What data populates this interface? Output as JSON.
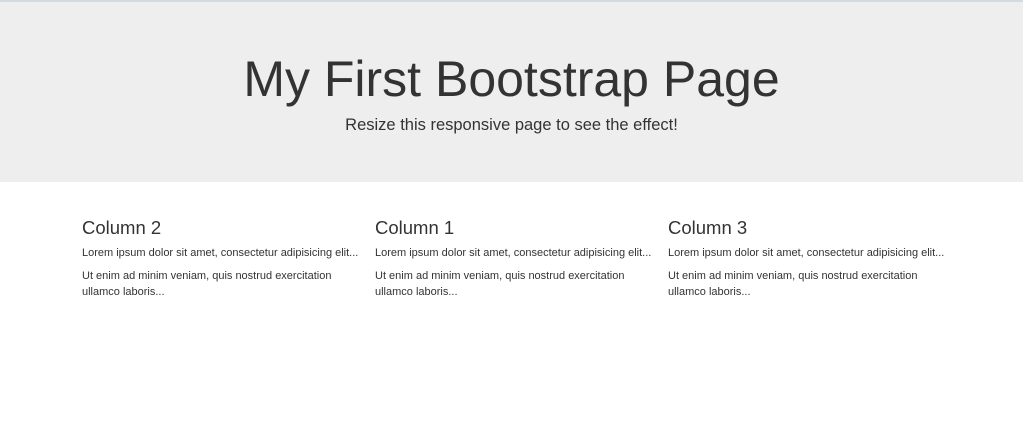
{
  "jumbotron": {
    "title": "My First Bootstrap Page",
    "subtitle": "Resize this responsive page to see the effect!"
  },
  "columns": [
    {
      "heading": "Column 2",
      "paragraph1": "Lorem ipsum dolor sit amet, consectetur adipisicing elit...",
      "paragraph2": "Ut enim ad minim veniam, quis nostrud exercitation ullamco laboris..."
    },
    {
      "heading": "Column 1",
      "paragraph1": "Lorem ipsum dolor sit amet, consectetur adipisicing elit...",
      "paragraph2": "Ut enim ad minim veniam, quis nostrud exercitation ullamco laboris..."
    },
    {
      "heading": "Column 3",
      "paragraph1": "Lorem ipsum dolor sit amet, consectetur adipisicing elit...",
      "paragraph2": "Ut enim ad minim veniam, quis nostrud exercitation ullamco laboris..."
    }
  ],
  "colors": {
    "jumbotron_bg": "#eeeeee",
    "text": "#333333",
    "page_bg": "#ffffff"
  }
}
